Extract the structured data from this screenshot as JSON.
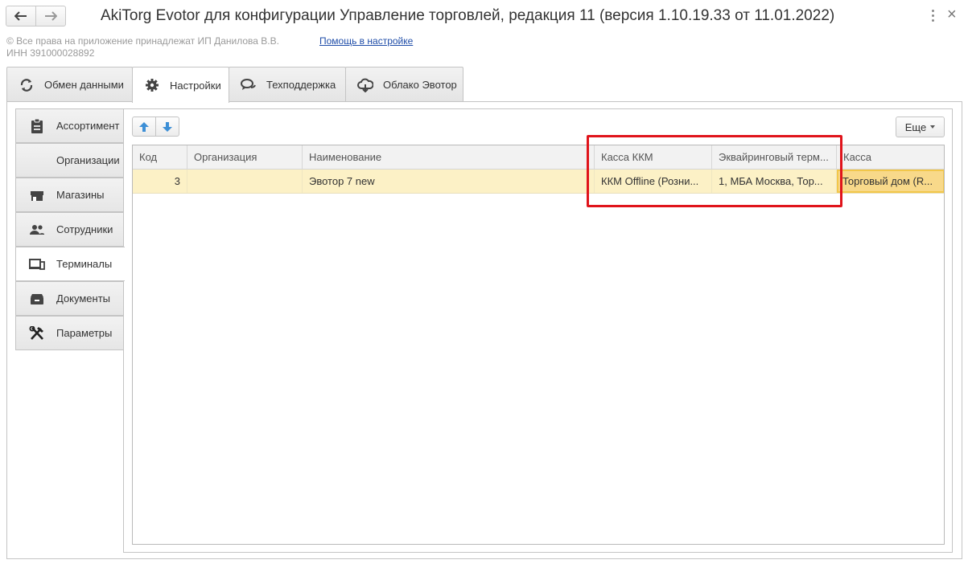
{
  "window": {
    "title": "AkiTorg Evotor для конфигурации Управление торговлей, редакция 11 (версия 1.10.19.33 от 11.01.2022)",
    "close_glyph": "×"
  },
  "header": {
    "copyright_line1": "© Все права на приложение принадлежат ИП Данилова В.В.",
    "copyright_line2": "ИНН 391000028892",
    "help_link": "Помощь в настройке"
  },
  "top_tabs": [
    {
      "label": "Обмен данными",
      "icon": "sync-icon"
    },
    {
      "label": "Настройки",
      "icon": "gear-icon",
      "active": true
    },
    {
      "label": "Техподдержка",
      "icon": "chat-icon"
    },
    {
      "label": "Облако Эвотор",
      "icon": "cloud-icon"
    }
  ],
  "side_tabs": [
    {
      "label": "Ассортимент",
      "icon": "clipboard-icon"
    },
    {
      "label": "Организации",
      "icon": ""
    },
    {
      "label": "Магазины",
      "icon": "store-icon"
    },
    {
      "label": "Сотрудники",
      "icon": "people-icon"
    },
    {
      "label": "Терминалы",
      "icon": "terminal-icon",
      "active": true
    },
    {
      "label": "Документы",
      "icon": "documents-icon"
    },
    {
      "label": "Параметры",
      "icon": "tools-icon"
    }
  ],
  "toolbar": {
    "more_label": "Еще"
  },
  "table": {
    "columns": [
      "Код",
      "Организация",
      "Наименование",
      "Касса ККМ",
      "Эквайринговый терм...",
      "Касса"
    ],
    "rows": [
      {
        "code": "3",
        "organization": "",
        "name": "Эвотор 7 new",
        "kkm": "ККМ Offline (Розни...",
        "acquiring": "1, МБА Москва, Тор...",
        "cash": "Торговый дом (R..."
      }
    ]
  },
  "colors": {
    "selected_row": "#fcf1c6",
    "selected_cell": "#f8d98a",
    "highlight_box": "#e0141b",
    "link": "#1f4da8"
  }
}
